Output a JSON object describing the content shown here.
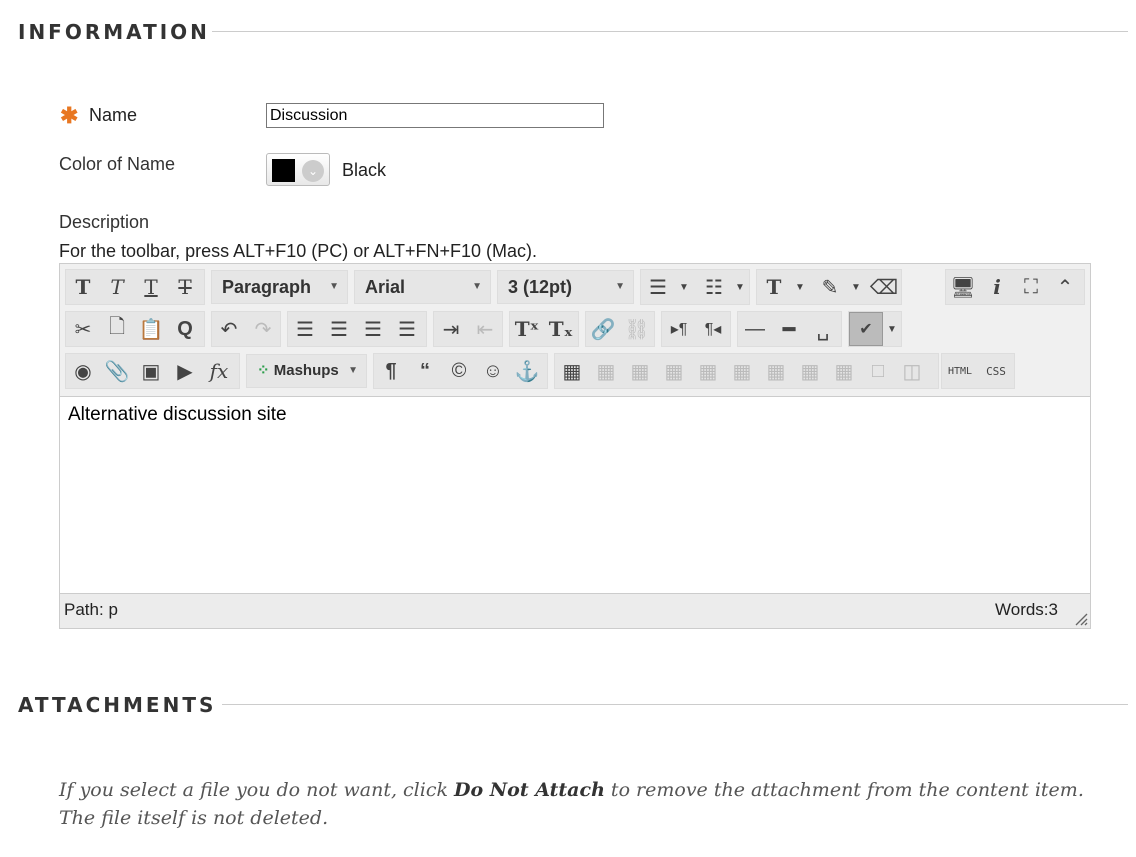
{
  "information": {
    "heading": "INFORMATION"
  },
  "name_field": {
    "required_marker": "✱",
    "label": "Name",
    "value": "Discussion"
  },
  "color_field": {
    "label": "Color of Name",
    "value_label": "Black",
    "swatch_color": "#000000"
  },
  "description": {
    "label": "Description",
    "instructions": "For the toolbar, press ALT+F10 (PC) or ALT+FN+F10 (Mac).",
    "format_select": "Paragraph",
    "font_select": "Arial",
    "size_select": "3 (12pt)",
    "mashups_label": "Mashups",
    "html_label": "HTML",
    "css_label": "CSS",
    "content": "Alternative discussion site",
    "path_label": "Path:",
    "path_value": "p",
    "word_count": "Words:3"
  },
  "attachments": {
    "heading": "ATTACHMENTS",
    "note_before": "If you select a file you do not want, click ",
    "note_bold": "Do Not Attach",
    "note_after": " to remove the attachment from the content item. The file itself is not deleted."
  },
  "colors": {
    "required": "#e87722",
    "toolbar_bg": "#f0f0f0",
    "border": "#cccccc"
  }
}
